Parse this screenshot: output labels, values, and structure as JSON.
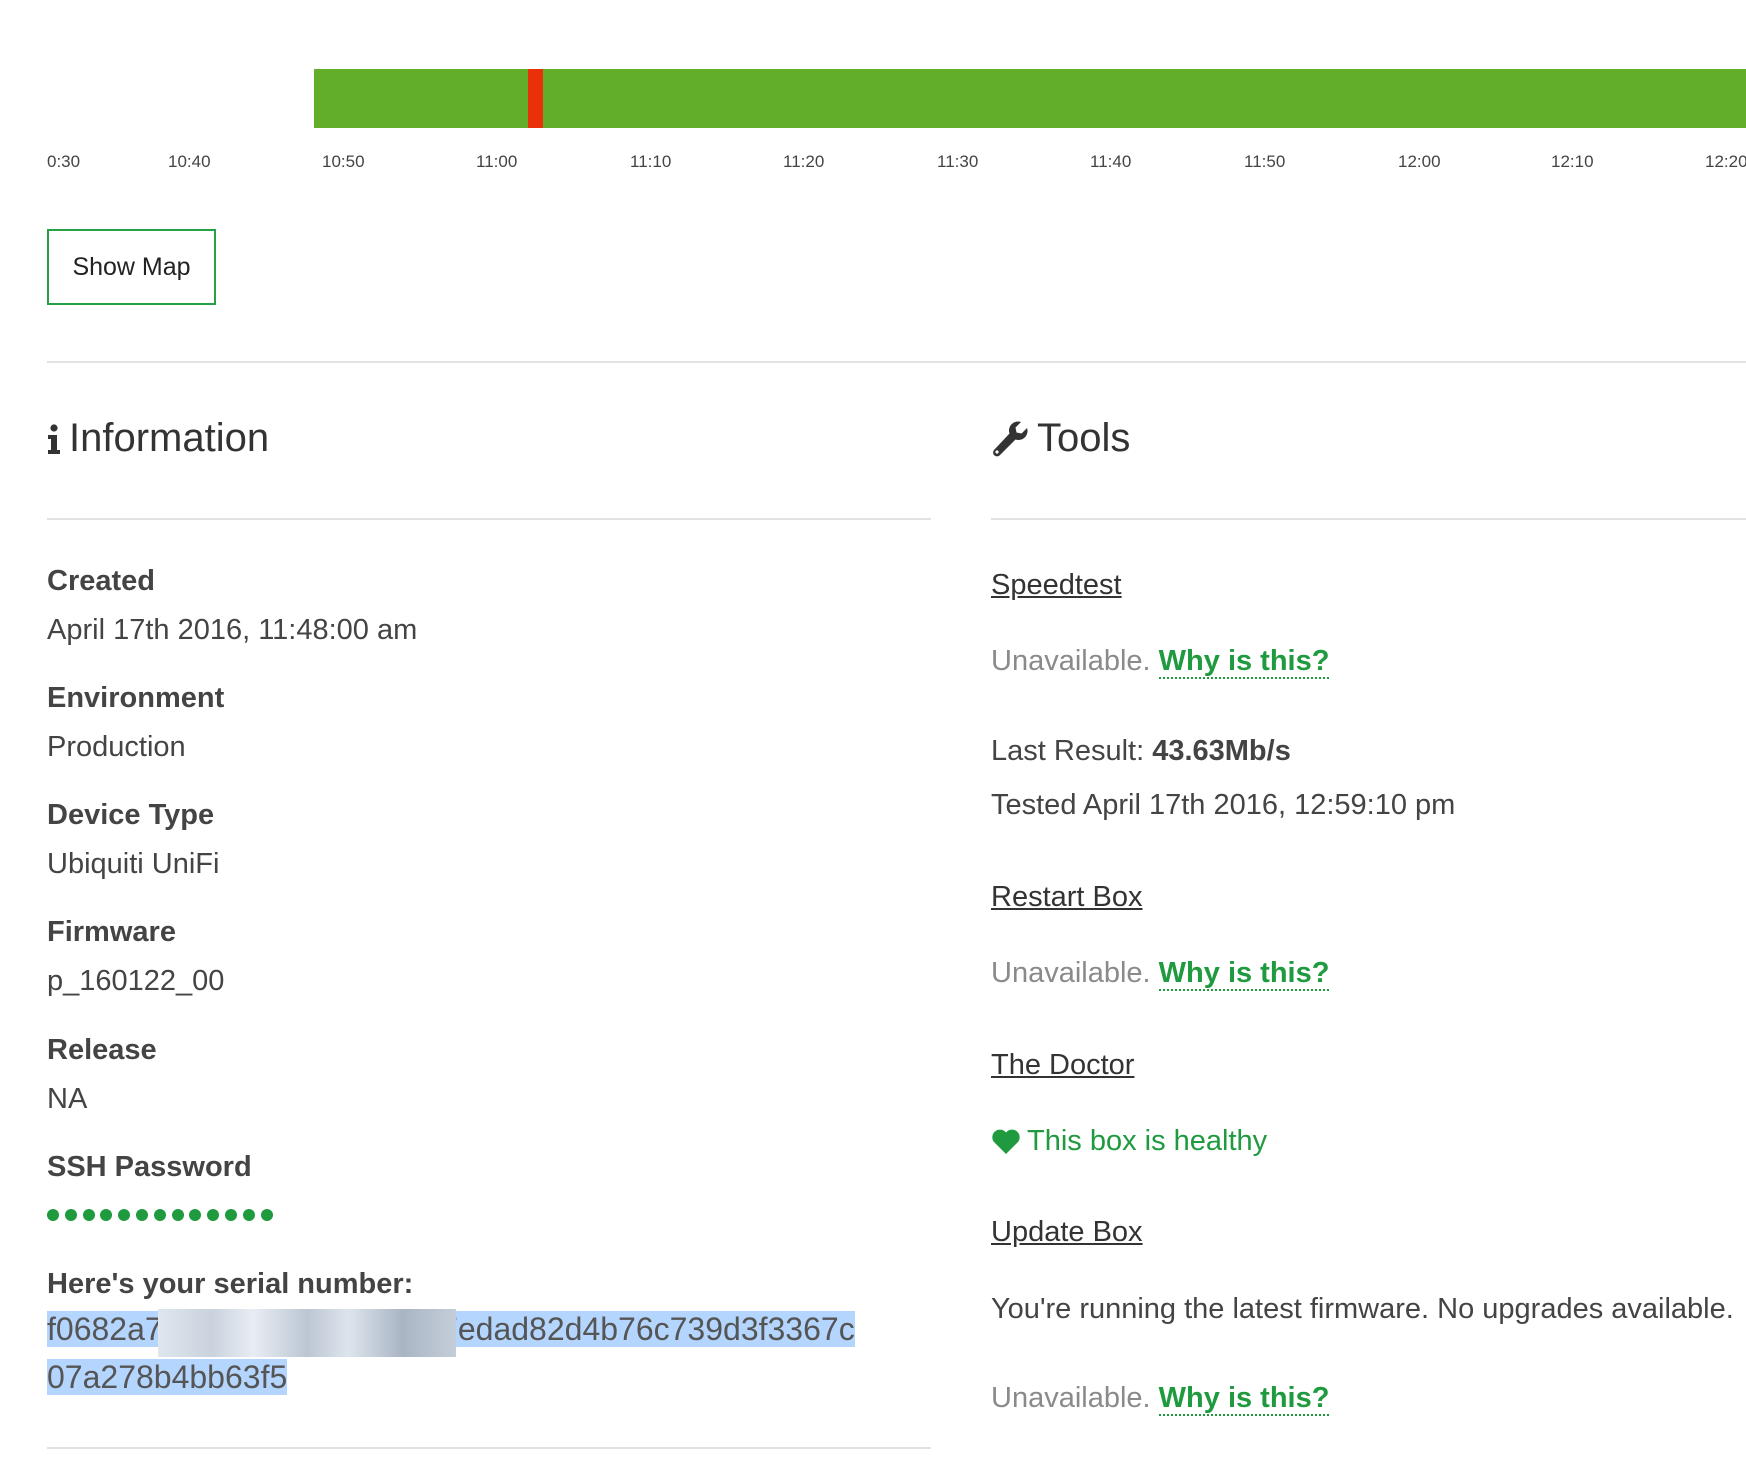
{
  "timeline": {
    "ticks": [
      "0:30",
      "10:40",
      "10:50",
      "11:00",
      "11:10",
      "11:20",
      "11:30",
      "11:40",
      "11:50",
      "12:00",
      "12:10",
      "12:20"
    ]
  },
  "actions": {
    "show_map": "Show Map"
  },
  "information": {
    "title": "Information",
    "created_label": "Created",
    "created_value": "April 17th 2016, 11:48:00 am",
    "environment_label": "Environment",
    "environment_value": "Production",
    "device_type_label": "Device Type",
    "device_type_value": "Ubiquiti UniFi",
    "firmware_label": "Firmware",
    "firmware_value": "p_160122_00",
    "release_label": "Release",
    "release_value": "NA",
    "ssh_label": "SSH Password",
    "serial_label": "Here's your serial number:",
    "serial_part1": "f0682a7",
    "serial_part2": "90a7edad82d4b76c739d3f3367c",
    "serial_part3": "07a278b4bb63f5"
  },
  "tools": {
    "title": "Tools",
    "speedtest_label": "Speedtest",
    "unavailable_text": "Unavailable.",
    "why_text": "Why is this?",
    "last_result_label": "Last Result:",
    "last_result_value": "43.63Mb/s",
    "tested_text": "Tested April 17th 2016, 12:59:10 pm",
    "restart_label": "Restart Box",
    "doctor_label": "The Doctor",
    "healthy_text": "This box is healthy",
    "update_label": "Update Box",
    "firmware_status": "You're running the latest firmware. No upgrades available."
  },
  "colors": {
    "accent": "#1f9a3f",
    "timeline_ok": "#62ae2b",
    "timeline_down": "#e8300a",
    "selection": "#b4d5fe"
  }
}
